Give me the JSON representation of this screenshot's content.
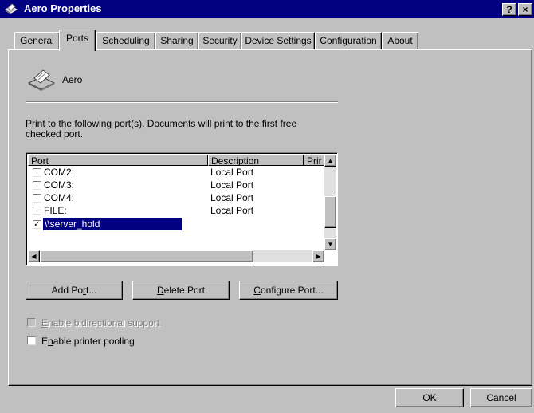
{
  "window": {
    "title": "Aero Properties",
    "help_button": "?",
    "close_button": "×"
  },
  "tabs": [
    "General",
    "Ports",
    "Scheduling",
    "Sharing",
    "Security",
    "Device Settings",
    "Configuration",
    "About"
  ],
  "active_tab": "Ports",
  "printer": {
    "name": "Aero",
    "icon": "printer-icon"
  },
  "instructions": {
    "line1_mnemonic": "P",
    "line1_rest": "rint to the following port(s).  Documents will print to the first free",
    "line2": "checked port."
  },
  "ports_list": {
    "columns": [
      "Port",
      "Description",
      "Prir"
    ],
    "rows": [
      {
        "port": "COM2:",
        "description": "Local Port",
        "checked": false
      },
      {
        "port": "COM3:",
        "description": "Local Port",
        "checked": false
      },
      {
        "port": "COM4:",
        "description": "Local Port",
        "checked": false
      },
      {
        "port": "FILE:",
        "description": "Local Port",
        "checked": false
      },
      {
        "port": "\\\\server_hold",
        "description": "",
        "checked": true,
        "selected": true
      }
    ]
  },
  "buttons": {
    "add_port_pre": "Add Po",
    "add_port_mn": "r",
    "add_port_post": "t...",
    "delete_port_mn": "D",
    "delete_port_post": "elete Port",
    "configure_port_mn": "C",
    "configure_port_post": "onfigure Port...",
    "ok": "OK",
    "cancel": "Cancel"
  },
  "options": {
    "bidirectional_mn": "E",
    "bidirectional_rest": "nable bidirectional support",
    "bidirectional_enabled": false,
    "pooling_mn": "n",
    "pooling_pre": "E",
    "pooling_rest": "able printer pooling",
    "pooling_checked": false
  },
  "colors": {
    "face": "#c0c0c0",
    "titlebar": "#000080",
    "selection": "#000080",
    "disabled_text": "#808080"
  }
}
